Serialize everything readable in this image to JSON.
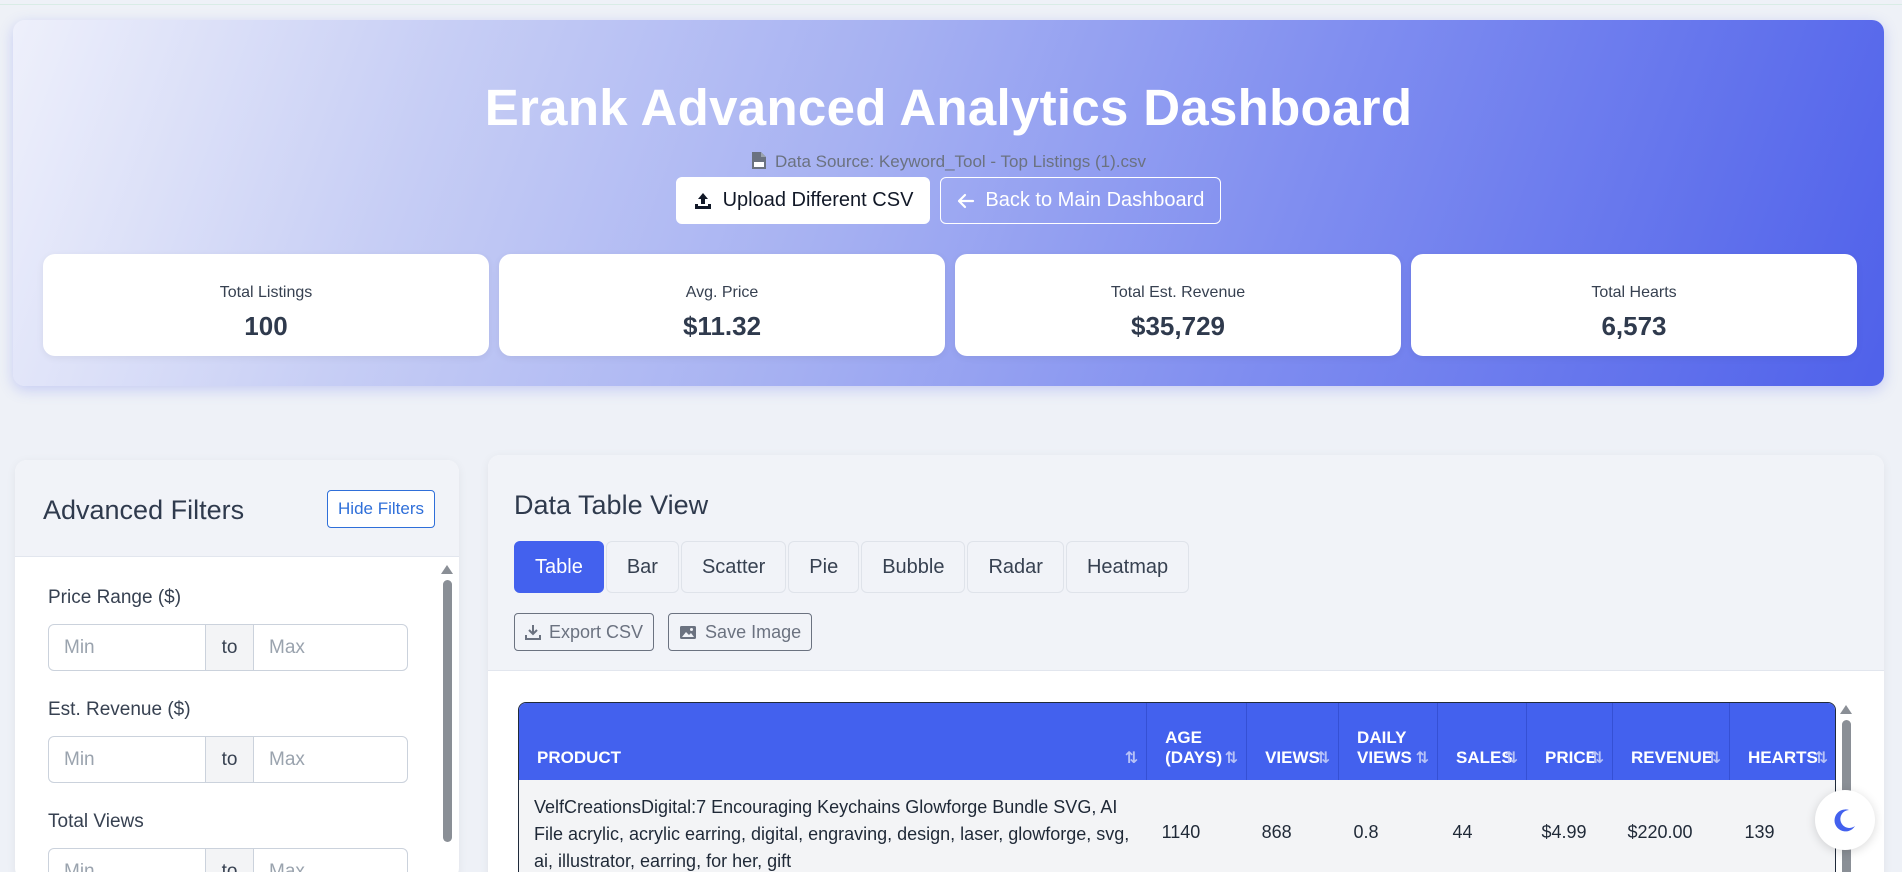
{
  "hero": {
    "title": "Erank Advanced Analytics Dashboard",
    "source_text": "Data Source: Keyword_Tool - Top Listings (1).csv",
    "upload_label": "Upload Different CSV",
    "back_label": "Back to Main Dashboard"
  },
  "stats": [
    {
      "label": "Total Listings",
      "value": "100"
    },
    {
      "label": "Avg. Price",
      "value": "$11.32"
    },
    {
      "label": "Total Est. Revenue",
      "value": "$35,729"
    },
    {
      "label": "Total Hearts",
      "value": "6,573"
    }
  ],
  "filters": {
    "title": "Advanced Filters",
    "hide_label": "Hide Filters",
    "groups": [
      {
        "label": "Price Range ($)",
        "min_placeholder": "Min",
        "to": "to",
        "max_placeholder": "Max"
      },
      {
        "label": "Est. Revenue ($)",
        "min_placeholder": "Min",
        "to": "to",
        "max_placeholder": "Max"
      },
      {
        "label": "Total Views",
        "min_placeholder": "Min",
        "to": "to",
        "max_placeholder": "Max"
      }
    ]
  },
  "main": {
    "title": "Data Table View",
    "tabs": [
      "Table",
      "Bar",
      "Scatter",
      "Pie",
      "Bubble",
      "Radar",
      "Heatmap"
    ],
    "active_tab": "Table",
    "export_label": "Export CSV",
    "save_label": "Save Image"
  },
  "table": {
    "columns": [
      "PRODUCT",
      "AGE (DAYS)",
      "VIEWS",
      "DAILY VIEWS",
      "SALES",
      "PRICE",
      "REVENUE",
      "HEARTS"
    ],
    "rows": [
      {
        "product": "VelfCreationsDigital:7 Encouraging Keychains Glowforge Bundle SVG, AI File acrylic, acrylic earring, digital, engraving, design, laser, glowforge, svg, ai, illustrator, earring, for her, gift",
        "age": "1140",
        "views": "868",
        "daily_views": "0.8",
        "sales": "44",
        "price": "$4.99",
        "revenue": "$220.00",
        "hearts": "139"
      }
    ]
  },
  "colors": {
    "accent": "#4361ee",
    "hero_start": "#eef0fb",
    "hero_end": "#4f61ea"
  }
}
